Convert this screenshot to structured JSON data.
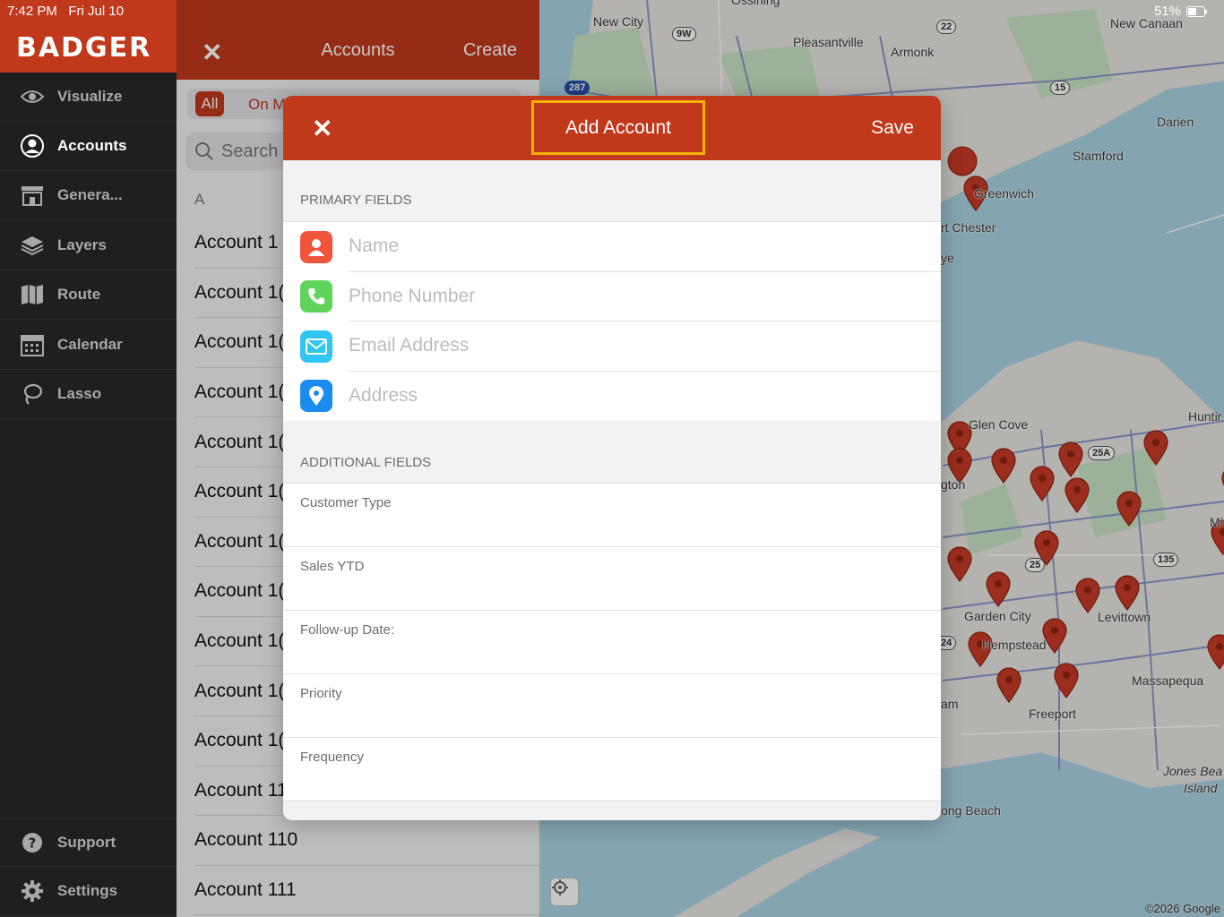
{
  "status_bar": {
    "time": "7:42 PM",
    "date": "Fri Jul 10",
    "battery": "51%"
  },
  "brand": {
    "name": "BADGER"
  },
  "sidebar": {
    "items": [
      {
        "label": "Visualize",
        "icon": "eye-icon"
      },
      {
        "label": "Accounts",
        "icon": "person-circle-icon"
      },
      {
        "label": "Genera...",
        "icon": "storefront-icon"
      },
      {
        "label": "Layers",
        "icon": "layers-icon"
      },
      {
        "label": "Route",
        "icon": "map-icon"
      },
      {
        "label": "Calendar",
        "icon": "calendar-icon"
      },
      {
        "label": "Lasso",
        "icon": "lasso-icon"
      }
    ],
    "bottom_items": [
      {
        "label": "Support",
        "icon": "question-icon"
      },
      {
        "label": "Settings",
        "icon": "gear-icon"
      }
    ]
  },
  "accounts_panel": {
    "title": "Accounts",
    "create_label": "Create",
    "filter_all": "All",
    "filter_on_map": "On M",
    "search_placeholder": "Search",
    "section_letter": "A",
    "rows": [
      "Account 1",
      "Account 1(",
      "Account 1(",
      "Account 1(",
      "Account 1(",
      "Account 1(",
      "Account 1(",
      "Account 1(",
      "Account 1(",
      "Account 1(",
      "Account 1(",
      "Account 11",
      "Account 110",
      "Account 111"
    ]
  },
  "modal": {
    "title": "Add Account",
    "save_label": "Save",
    "primary_header": "PRIMARY FIELDS",
    "primary_fields": [
      {
        "placeholder": "Name",
        "icon": "person-icon",
        "color": "#f0543a"
      },
      {
        "placeholder": "Phone Number",
        "icon": "phone-icon",
        "color": "#5fd35a"
      },
      {
        "placeholder": "Email Address",
        "icon": "envelope-icon",
        "color": "#2fc6f2"
      },
      {
        "placeholder": "Address",
        "icon": "pin-icon",
        "color": "#1a8cf0"
      }
    ],
    "additional_header": "ADDITIONAL FIELDS",
    "additional_fields": [
      "Customer Type",
      "Sales YTD",
      "Follow-up Date:",
      "Priority",
      "Frequency"
    ]
  },
  "map": {
    "labels": [
      "New City",
      "Pleasantville",
      "Armonk",
      "New Canaan",
      "Darien",
      "Stamford",
      "Greenwich",
      "rt Chester",
      "ye",
      "Glen Cove",
      "Huntir",
      "gton",
      "Garden City",
      "Levittown",
      "Hempstead",
      "Massapequa",
      "Freeport",
      "am",
      "Jones Bea",
      "Island",
      "ong Beach",
      "Mi",
      "Ossining"
    ],
    "shields": [
      "9W",
      "22",
      "287",
      "15",
      "25A",
      "25",
      "135",
      "24"
    ],
    "copyright": "©2026 Google"
  },
  "colors": {
    "brand": "#c0391b",
    "highlight": "#f6b400",
    "sidebar_bg": "#1f1f1f"
  }
}
